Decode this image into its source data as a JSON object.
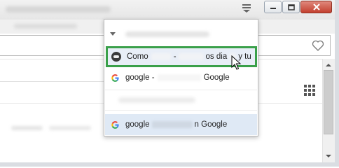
{
  "window": {
    "minimize_icon": "minimize-icon",
    "maximize_icon": "maximize-icon",
    "close_icon": "close-icon",
    "close_color": "#c3402f"
  },
  "toolbar": {
    "tab_menu_icon": "tab-list-menu-icon",
    "bookmark_icon": "heart-icon",
    "apps_icon": "apps-grid-icon"
  },
  "dropdown": {
    "items": [
      {
        "icon": "site-favicon",
        "text_start": "Como",
        "text_mid": "-",
        "text_end": "os dia",
        "text_tail": "y tu",
        "highlighted": true
      },
      {
        "icon": "google-g-icon",
        "text_start": "google -",
        "text_end": "Google"
      },
      {
        "icon": "google-g-icon",
        "text_start": "google",
        "text_end": "n Google",
        "selected": true
      }
    ],
    "highlight_color": "#3aa04a",
    "selected_bg": "#dfe9f5"
  }
}
